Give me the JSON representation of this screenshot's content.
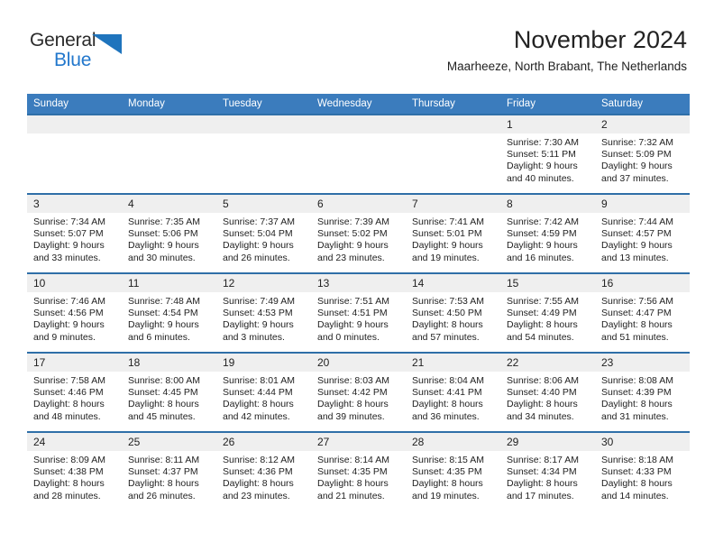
{
  "brand": {
    "name_dark": "General",
    "name_light": "Blue",
    "accent_color": "#2277cc",
    "triangle_color": "#1f74bd"
  },
  "header": {
    "title": "November 2024",
    "subtitle": "Maarheeze, North Brabant, The Netherlands"
  },
  "calendar": {
    "header_bg": "#3b7cbd",
    "header_text_color": "#ffffff",
    "daynum_bg": "#efefef",
    "row_separator_color": "#2f6fa8",
    "weekdays": [
      "Sunday",
      "Monday",
      "Tuesday",
      "Wednesday",
      "Thursday",
      "Friday",
      "Saturday"
    ],
    "weeks": [
      [
        {
          "day": "",
          "empty": true
        },
        {
          "day": "",
          "empty": true
        },
        {
          "day": "",
          "empty": true
        },
        {
          "day": "",
          "empty": true
        },
        {
          "day": "",
          "empty": true
        },
        {
          "day": "1",
          "sunrise": "Sunrise: 7:30 AM",
          "sunset": "Sunset: 5:11 PM",
          "daylight_1": "Daylight: 9 hours",
          "daylight_2": "and 40 minutes."
        },
        {
          "day": "2",
          "sunrise": "Sunrise: 7:32 AM",
          "sunset": "Sunset: 5:09 PM",
          "daylight_1": "Daylight: 9 hours",
          "daylight_2": "and 37 minutes."
        }
      ],
      [
        {
          "day": "3",
          "sunrise": "Sunrise: 7:34 AM",
          "sunset": "Sunset: 5:07 PM",
          "daylight_1": "Daylight: 9 hours",
          "daylight_2": "and 33 minutes."
        },
        {
          "day": "4",
          "sunrise": "Sunrise: 7:35 AM",
          "sunset": "Sunset: 5:06 PM",
          "daylight_1": "Daylight: 9 hours",
          "daylight_2": "and 30 minutes."
        },
        {
          "day": "5",
          "sunrise": "Sunrise: 7:37 AM",
          "sunset": "Sunset: 5:04 PM",
          "daylight_1": "Daylight: 9 hours",
          "daylight_2": "and 26 minutes."
        },
        {
          "day": "6",
          "sunrise": "Sunrise: 7:39 AM",
          "sunset": "Sunset: 5:02 PM",
          "daylight_1": "Daylight: 9 hours",
          "daylight_2": "and 23 minutes."
        },
        {
          "day": "7",
          "sunrise": "Sunrise: 7:41 AM",
          "sunset": "Sunset: 5:01 PM",
          "daylight_1": "Daylight: 9 hours",
          "daylight_2": "and 19 minutes."
        },
        {
          "day": "8",
          "sunrise": "Sunrise: 7:42 AM",
          "sunset": "Sunset: 4:59 PM",
          "daylight_1": "Daylight: 9 hours",
          "daylight_2": "and 16 minutes."
        },
        {
          "day": "9",
          "sunrise": "Sunrise: 7:44 AM",
          "sunset": "Sunset: 4:57 PM",
          "daylight_1": "Daylight: 9 hours",
          "daylight_2": "and 13 minutes."
        }
      ],
      [
        {
          "day": "10",
          "sunrise": "Sunrise: 7:46 AM",
          "sunset": "Sunset: 4:56 PM",
          "daylight_1": "Daylight: 9 hours",
          "daylight_2": "and 9 minutes."
        },
        {
          "day": "11",
          "sunrise": "Sunrise: 7:48 AM",
          "sunset": "Sunset: 4:54 PM",
          "daylight_1": "Daylight: 9 hours",
          "daylight_2": "and 6 minutes."
        },
        {
          "day": "12",
          "sunrise": "Sunrise: 7:49 AM",
          "sunset": "Sunset: 4:53 PM",
          "daylight_1": "Daylight: 9 hours",
          "daylight_2": "and 3 minutes."
        },
        {
          "day": "13",
          "sunrise": "Sunrise: 7:51 AM",
          "sunset": "Sunset: 4:51 PM",
          "daylight_1": "Daylight: 9 hours",
          "daylight_2": "and 0 minutes."
        },
        {
          "day": "14",
          "sunrise": "Sunrise: 7:53 AM",
          "sunset": "Sunset: 4:50 PM",
          "daylight_1": "Daylight: 8 hours",
          "daylight_2": "and 57 minutes."
        },
        {
          "day": "15",
          "sunrise": "Sunrise: 7:55 AM",
          "sunset": "Sunset: 4:49 PM",
          "daylight_1": "Daylight: 8 hours",
          "daylight_2": "and 54 minutes."
        },
        {
          "day": "16",
          "sunrise": "Sunrise: 7:56 AM",
          "sunset": "Sunset: 4:47 PM",
          "daylight_1": "Daylight: 8 hours",
          "daylight_2": "and 51 minutes."
        }
      ],
      [
        {
          "day": "17",
          "sunrise": "Sunrise: 7:58 AM",
          "sunset": "Sunset: 4:46 PM",
          "daylight_1": "Daylight: 8 hours",
          "daylight_2": "and 48 minutes."
        },
        {
          "day": "18",
          "sunrise": "Sunrise: 8:00 AM",
          "sunset": "Sunset: 4:45 PM",
          "daylight_1": "Daylight: 8 hours",
          "daylight_2": "and 45 minutes."
        },
        {
          "day": "19",
          "sunrise": "Sunrise: 8:01 AM",
          "sunset": "Sunset: 4:44 PM",
          "daylight_1": "Daylight: 8 hours",
          "daylight_2": "and 42 minutes."
        },
        {
          "day": "20",
          "sunrise": "Sunrise: 8:03 AM",
          "sunset": "Sunset: 4:42 PM",
          "daylight_1": "Daylight: 8 hours",
          "daylight_2": "and 39 minutes."
        },
        {
          "day": "21",
          "sunrise": "Sunrise: 8:04 AM",
          "sunset": "Sunset: 4:41 PM",
          "daylight_1": "Daylight: 8 hours",
          "daylight_2": "and 36 minutes."
        },
        {
          "day": "22",
          "sunrise": "Sunrise: 8:06 AM",
          "sunset": "Sunset: 4:40 PM",
          "daylight_1": "Daylight: 8 hours",
          "daylight_2": "and 34 minutes."
        },
        {
          "day": "23",
          "sunrise": "Sunrise: 8:08 AM",
          "sunset": "Sunset: 4:39 PM",
          "daylight_1": "Daylight: 8 hours",
          "daylight_2": "and 31 minutes."
        }
      ],
      [
        {
          "day": "24",
          "sunrise": "Sunrise: 8:09 AM",
          "sunset": "Sunset: 4:38 PM",
          "daylight_1": "Daylight: 8 hours",
          "daylight_2": "and 28 minutes."
        },
        {
          "day": "25",
          "sunrise": "Sunrise: 8:11 AM",
          "sunset": "Sunset: 4:37 PM",
          "daylight_1": "Daylight: 8 hours",
          "daylight_2": "and 26 minutes."
        },
        {
          "day": "26",
          "sunrise": "Sunrise: 8:12 AM",
          "sunset": "Sunset: 4:36 PM",
          "daylight_1": "Daylight: 8 hours",
          "daylight_2": "and 23 minutes."
        },
        {
          "day": "27",
          "sunrise": "Sunrise: 8:14 AM",
          "sunset": "Sunset: 4:35 PM",
          "daylight_1": "Daylight: 8 hours",
          "daylight_2": "and 21 minutes."
        },
        {
          "day": "28",
          "sunrise": "Sunrise: 8:15 AM",
          "sunset": "Sunset: 4:35 PM",
          "daylight_1": "Daylight: 8 hours",
          "daylight_2": "and 19 minutes."
        },
        {
          "day": "29",
          "sunrise": "Sunrise: 8:17 AM",
          "sunset": "Sunset: 4:34 PM",
          "daylight_1": "Daylight: 8 hours",
          "daylight_2": "and 17 minutes."
        },
        {
          "day": "30",
          "sunrise": "Sunrise: 8:18 AM",
          "sunset": "Sunset: 4:33 PM",
          "daylight_1": "Daylight: 8 hours",
          "daylight_2": "and 14 minutes."
        }
      ]
    ]
  }
}
